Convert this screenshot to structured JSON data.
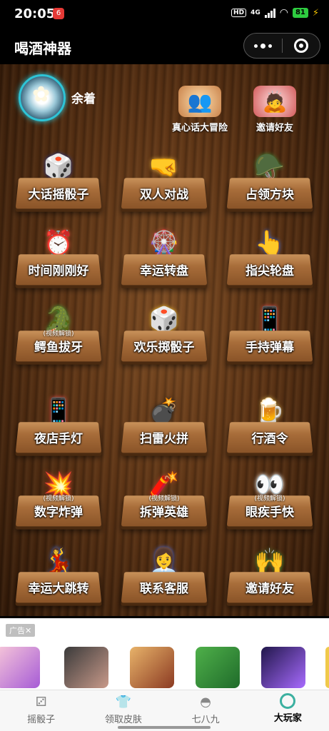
{
  "status_bar": {
    "time": "20:05",
    "app_badge": "6",
    "hd": "HD",
    "network": "4G",
    "battery": "81"
  },
  "title_bar": {
    "title": "喝酒神器"
  },
  "header": {
    "username": "余着",
    "truth_label": "真心话大冒险",
    "invite_label": "邀请好友"
  },
  "games": [
    {
      "label": "大话摇骰子",
      "icon": "dice-cup-icon",
      "unlock": ""
    },
    {
      "label": "双人对战",
      "icon": "fist-bump-icon",
      "unlock": ""
    },
    {
      "label": "占领方块",
      "icon": "soldiers-icon",
      "unlock": ""
    },
    {
      "label": "时间刚刚好",
      "icon": "alarm-clock-icon",
      "unlock": ""
    },
    {
      "label": "幸运转盘",
      "icon": "wheel-icon",
      "unlock": ""
    },
    {
      "label": "指尖轮盘",
      "icon": "finger-spin-icon",
      "unlock": ""
    },
    {
      "label": "鳄鱼拔牙",
      "icon": "crocodile-icon",
      "unlock": "(视频解锁)"
    },
    {
      "label": "欢乐掷骰子",
      "icon": "dice-icon",
      "unlock": ""
    },
    {
      "label": "手持弹幕",
      "icon": "phone-hand-icon",
      "unlock": ""
    },
    {
      "label": "夜店手灯",
      "icon": "phone-light-icon",
      "unlock": ""
    },
    {
      "label": "扫雷火拼",
      "icon": "bomb-icon",
      "unlock": ""
    },
    {
      "label": "行酒令",
      "icon": "wine-hands-icon",
      "unlock": ""
    },
    {
      "label": "数字炸弹",
      "icon": "number-bomb-icon",
      "unlock": "(视频解锁)"
    },
    {
      "label": "拆弹英雄",
      "icon": "dynamite-icon",
      "unlock": "(视频解锁)"
    },
    {
      "label": "眼疾手快",
      "icon": "eyes-icon",
      "unlock": "(视频解锁)"
    },
    {
      "label": "幸运大跳转",
      "icon": "dancers-icon",
      "unlock": ""
    },
    {
      "label": "联系客服",
      "icon": "service-staff-icon",
      "unlock": ""
    },
    {
      "label": "邀请好友",
      "icon": "friends-icon",
      "unlock": ""
    }
  ],
  "ad": {
    "badge": "广告✕"
  },
  "tabs": [
    {
      "label": "摇骰子",
      "icon": "dice-tab-icon"
    },
    {
      "label": "领取皮肤",
      "icon": "shirt-tab-icon"
    },
    {
      "label": "七八九",
      "icon": "bowl-tab-icon"
    },
    {
      "label": "大玩家",
      "icon": "ring-tab-icon"
    }
  ],
  "colors": {
    "wood_dark": "#2e1707",
    "wood_light": "#7a4a22",
    "plank": "#a86d3a",
    "avatar_ring": "#2ec4d6",
    "battery": "#2ecc40"
  }
}
